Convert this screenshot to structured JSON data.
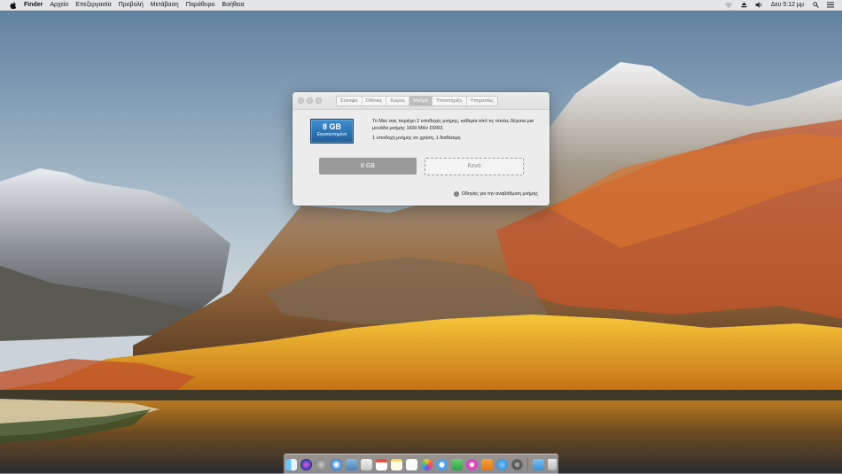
{
  "menubar": {
    "app_name": "Finder",
    "items": [
      "Αρχείο",
      "Επεξεργασία",
      "Προβολή",
      "Μετάβαση",
      "Παράθυρο",
      "Βοήθεια"
    ],
    "clock": "Δευ 5:12 μμ"
  },
  "window": {
    "tabs": [
      {
        "label": "Σύνοψη",
        "active": false
      },
      {
        "label": "Οθόνες",
        "active": false
      },
      {
        "label": "Χώρος",
        "active": false
      },
      {
        "label": "Μνήμη",
        "active": true
      },
      {
        "label": "Υποστήριξη",
        "active": false
      },
      {
        "label": "Υπηρεσίες",
        "active": false
      }
    ],
    "memory": {
      "icon_size": "8 GB",
      "icon_status": "Εγκατεστημένη",
      "description": "Το Mac σας περιέχει 2 υποδοχές μνήμης, καθεμία από τις οποίες δέχεται μια μονάδα μνήμης 1600 MHz DDR3.",
      "slots_info": "1 υποδοχή μνήμης σε χρήση, 1 διαθέσιμη",
      "slot_1": "8 GB",
      "slot_2": "Κενό",
      "upgrade_link": "Οδηγίες για την αναβάθμιση μνήμης"
    }
  },
  "dock": {
    "icons": [
      "finder-icon",
      "siri-icon",
      "launchpad-icon",
      "safari-icon",
      "preview-icon",
      "mail-icon",
      "calendar-icon",
      "notes-icon",
      "reminders-icon",
      "photos-icon",
      "messages-icon",
      "facetime-icon",
      "itunes-icon",
      "ibooks-icon",
      "app-store-icon",
      "system-preferences-icon",
      "downloads-icon",
      "trash-icon"
    ]
  },
  "colors": {
    "accent": "#2f74b5",
    "slot_filled": "#9a9a9a"
  }
}
